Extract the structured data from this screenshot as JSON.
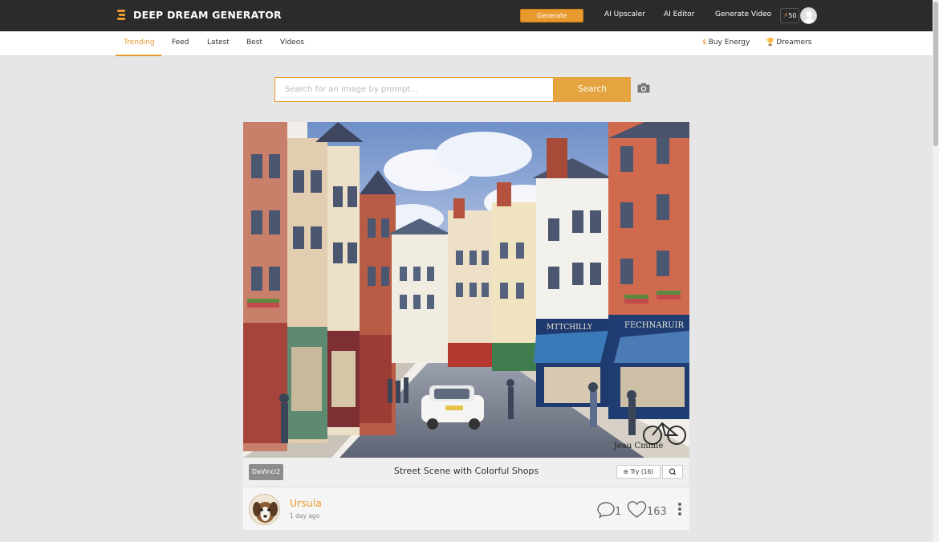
{
  "header": {
    "logo_text": "DEEP DREAM GENERATOR",
    "generate_label": "Generate",
    "nav": [
      "AI Upscaler",
      "AI Editor",
      "Generate Video"
    ],
    "energy": "50",
    "accent": "#e89a2e"
  },
  "subnav": {
    "tabs": [
      "Trending",
      "Feed",
      "Latest",
      "Best",
      "Videos"
    ],
    "active_tab": "Trending",
    "right": [
      "Buy Energy",
      "Dreamers"
    ]
  },
  "search": {
    "placeholder": "Search for an image by prompt...",
    "button_label": "Search"
  },
  "post": {
    "model": "DaVinci2",
    "title": "Street Scene with Colorful Shops",
    "try_label": "Try (16)",
    "user": "Ursula",
    "time": "1 day ago",
    "comments": "1",
    "likes": "163",
    "signature": "Jeau Cmmie"
  }
}
